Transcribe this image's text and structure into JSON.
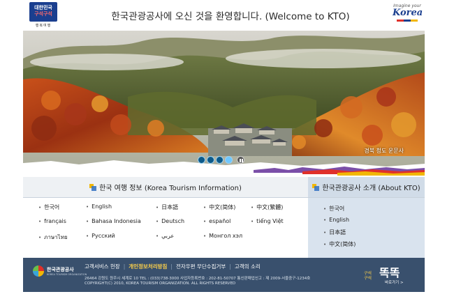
{
  "header": {
    "logo_left": {
      "line1": "대한민국",
      "line2": "구석구석",
      "sub": "행복여행"
    },
    "welcome": "한국관광공사에 오신 것을 환영합니다. (Welcome to KTO)",
    "logo_right": {
      "tagline": "Imagine your",
      "brand": "Korea"
    }
  },
  "hero": {
    "caption": "경북 청도 운문사",
    "slides": 4,
    "active_slide": 4
  },
  "tourism_info": {
    "title": "한국 여행 정보 (Korea Tourism Information)",
    "rows": [
      [
        "한국어",
        "English",
        "日本語",
        "中文(简体)",
        "中文(繁體)"
      ],
      [
        "français",
        "Bahasa Indonesia",
        "Deutsch",
        "español",
        "tiếng Việt"
      ],
      [
        "ภาษาไทย",
        "Русский",
        "عربي",
        "Монгол хэл"
      ]
    ]
  },
  "about_kto": {
    "title": "한국관광공사 소개 (About KTO)",
    "items": [
      "한국어",
      "English",
      "日本語",
      "中文(简体)"
    ]
  },
  "footer": {
    "logo_name": "한국관광공사",
    "logo_eng": "KOREA TOURISM ORGANIZATION",
    "links": [
      {
        "label": "고객서비스 헌장",
        "highlight": false
      },
      {
        "label": "개인정보처리방침",
        "highlight": true
      },
      {
        "label": "전자우편 무단수집거부",
        "highlight": false
      },
      {
        "label": "고객의 소리",
        "highlight": false
      }
    ],
    "address": "26464 강원도 원주시 세계로 10 TEL : (033)738-3000 사업자등록번호 : 202-81-50707 통신판매업신고 : 제 2009-서울중구-1234호",
    "copyright": "COPYRIGHT(C) 2010, KOREA TOURISM ORGANIZATION. ALL RIGHTS RESERVED",
    "badge_small_1": "구석",
    "badge_small_2": "구석",
    "badge_big": "똑똑",
    "badge_go": "바로가기 >"
  }
}
